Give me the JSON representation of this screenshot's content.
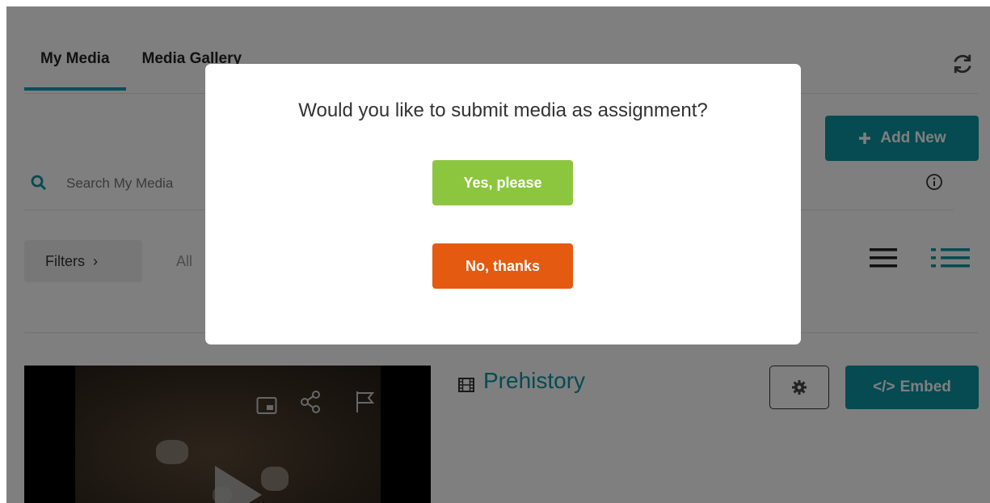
{
  "tabs": [
    {
      "label": "My Media"
    },
    {
      "label": "Media Gallery"
    }
  ],
  "toolbar": {
    "add_new_label": "Add New",
    "search_placeholder": "Search My Media",
    "filters_label": "Filters",
    "filters_chevron": "›",
    "all_label": "All"
  },
  "media_item": {
    "title": "Prehistory",
    "embed_label": "Embed",
    "embed_icon": "</>"
  },
  "modal": {
    "question": "Would you like to submit media as assignment?",
    "yes_label": "Yes, please",
    "no_label": "No, thanks"
  },
  "colors": {
    "accent": "#0a96a3",
    "yes_button": "#8cc63f",
    "no_button": "#e35a10"
  },
  "icons": [
    "refresh-icon",
    "plus-icon",
    "search-icon",
    "info-icon",
    "list-view-icon",
    "detail-view-icon",
    "film-icon",
    "gear-icon",
    "pip-icon",
    "share-icon",
    "flag-icon",
    "play-icon"
  ]
}
